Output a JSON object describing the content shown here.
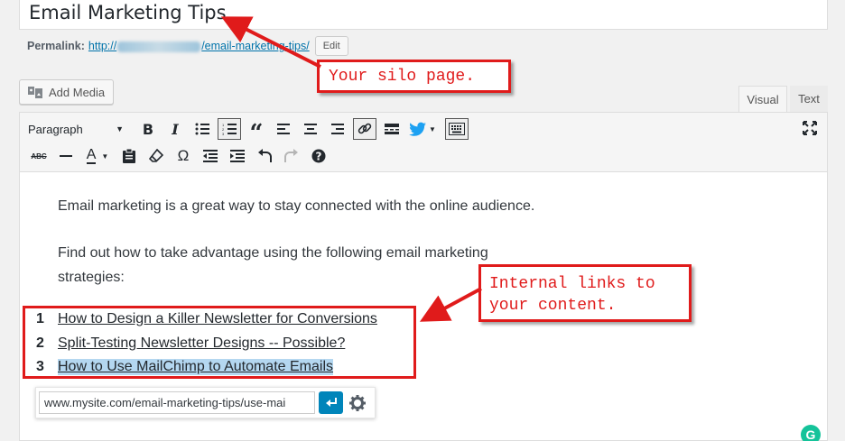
{
  "post_title": "Email Marketing Tips",
  "permalink": {
    "label": "Permalink:",
    "url_prefix": "http://",
    "url_suffix": "/email-marketing-tips/",
    "edit_label": "Edit"
  },
  "add_media_label": "Add Media",
  "tabs": {
    "visual": "Visual",
    "text": "Text"
  },
  "toolbar": {
    "format_select": "Paragraph"
  },
  "content": {
    "p1": "Email marketing is a great way to stay connected with the online audience.",
    "p2_line1": "Find out how to take advantage using the following email marketing",
    "p2_line2": "strategies:",
    "list": [
      {
        "num": "1",
        "text": "How to Design a Killer Newsletter for Conversions"
      },
      {
        "num": "2",
        "text": "Split-Testing Newsletter Designs -- Possible?"
      },
      {
        "num": "3",
        "text": "How to Use MailChimp to Automate Emails"
      }
    ]
  },
  "link_popup": {
    "url_value": "www.mysite.com/email-marketing-tips/use-mai"
  },
  "annotations": {
    "silo_callout": "Your silo page.",
    "links_callout_line1": "Internal links to",
    "links_callout_line2": "your content."
  },
  "colors": {
    "annotation_red": "#e01b1b",
    "link_blue": "#0073aa",
    "apply_button": "#0085ba",
    "selection": "#b4d7f0",
    "grammarly": "#15c39a"
  }
}
